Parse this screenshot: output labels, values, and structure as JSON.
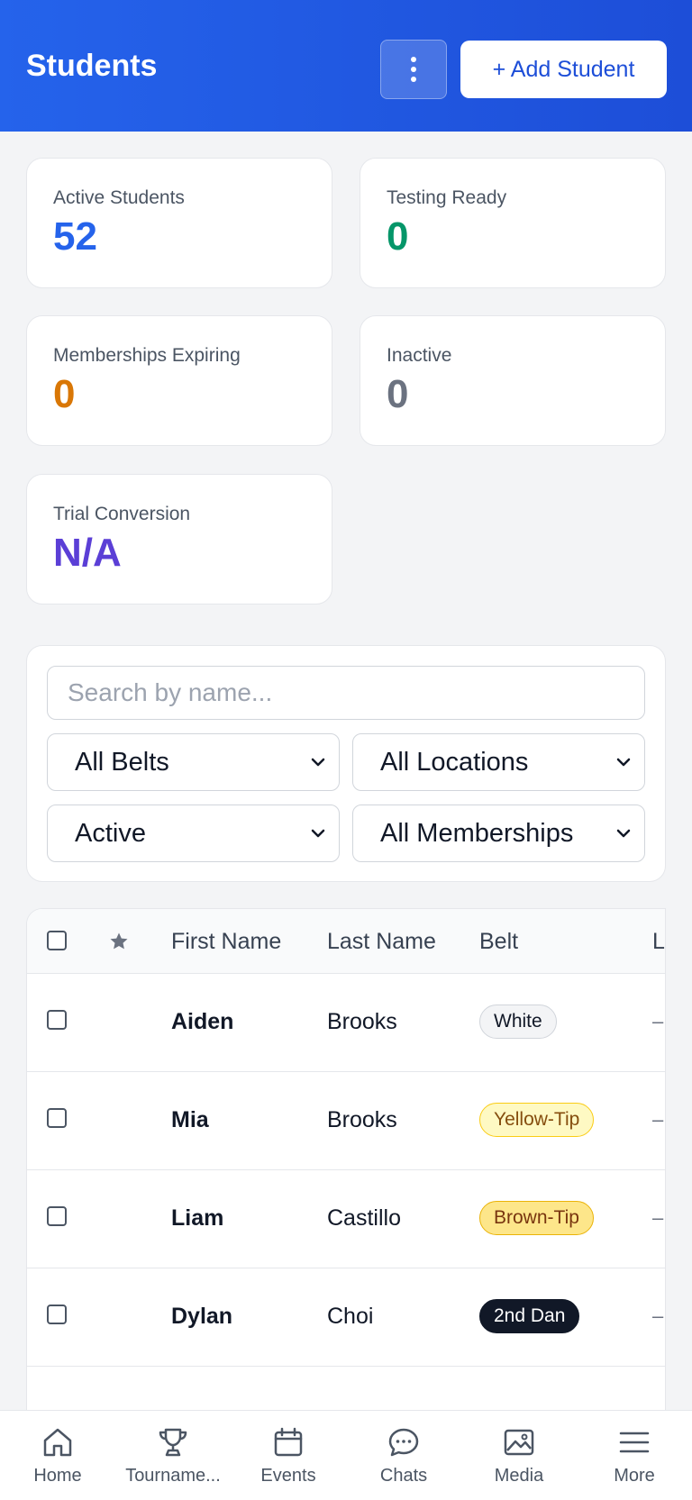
{
  "header": {
    "title": "Students",
    "add_label": "+ Add Student"
  },
  "stats": [
    {
      "label": "Active Students",
      "value": "52",
      "color": "#2563eb"
    },
    {
      "label": "Testing Ready",
      "value": "0",
      "color": "#059669"
    },
    {
      "label": "Memberships Expiring",
      "value": "0",
      "color": "#d97706"
    },
    {
      "label": "Inactive",
      "value": "0",
      "color": "#6b7280"
    },
    {
      "label": "Trial Conversion",
      "value": "N/A",
      "color": "#5b3fd6"
    }
  ],
  "filters": {
    "search_placeholder": "Search by name...",
    "belt": "All Belts",
    "location": "All Locations",
    "status": "Active",
    "membership": "All Memberships"
  },
  "table": {
    "columns": [
      "First Name",
      "Last Name",
      "Belt",
      "L"
    ],
    "rows": [
      {
        "first": "Aiden",
        "last": "Brooks",
        "belt": "White",
        "other": "–"
      },
      {
        "first": "Mia",
        "last": "Brooks",
        "belt": "Yellow-Tip",
        "other": "–"
      },
      {
        "first": "Liam",
        "last": "Castillo",
        "belt": "Brown-Tip",
        "other": "–"
      },
      {
        "first": "Dylan",
        "last": "Choi",
        "belt": "2nd Dan",
        "other": "–"
      }
    ]
  },
  "nav": [
    {
      "label": "Home",
      "icon": "home-icon"
    },
    {
      "label": "Tourname...",
      "icon": "trophy-icon"
    },
    {
      "label": "Events",
      "icon": "calendar-icon"
    },
    {
      "label": "Chats",
      "icon": "chat-icon"
    },
    {
      "label": "Media",
      "icon": "image-icon"
    },
    {
      "label": "More",
      "icon": "menu-icon"
    }
  ]
}
